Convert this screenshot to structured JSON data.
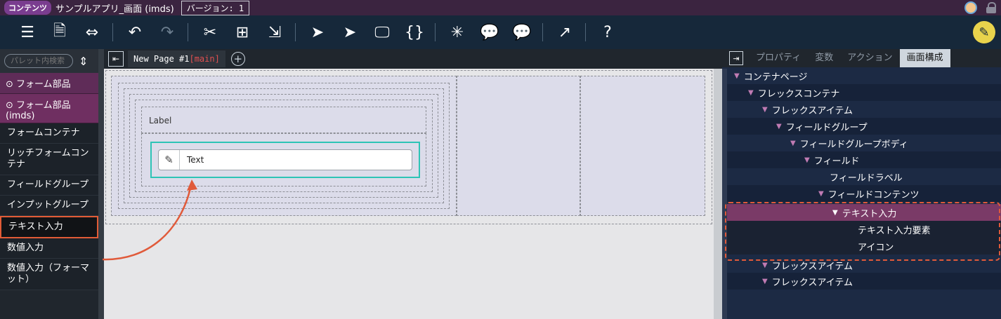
{
  "titlebar": {
    "badge": "コンテンツ",
    "app_title": "サンプルアプリ_画面 (imds)",
    "version": "バージョン: 1"
  },
  "toolbar": {
    "icons": [
      "database-stack-icon",
      "document-download-icon",
      "swap-horizontal-icon",
      "undo-icon",
      "redo-icon",
      "scissors-icon",
      "tree-grid-icon",
      "move-out-icon",
      "pointer-icon",
      "pointer-hover-icon",
      "monitor-icon",
      "css-file-icon",
      "sparkle-icon",
      "chat-edit-icon",
      "chat-settings-icon",
      "external-link-icon",
      "help-icon"
    ],
    "glyphs": [
      "☰",
      "🗎",
      "⇔",
      "↶",
      "↷",
      "✂",
      "⊞",
      "⇲",
      "➤",
      "➤",
      "🖵",
      "{}",
      "✳",
      "💬",
      "💬",
      "↗",
      "?"
    ],
    "edit_mode_icon": "pencil-circle-icon",
    "edit_mode_glyph": "✎"
  },
  "palette": {
    "search_placeholder": "パレット内検索",
    "categories": [
      {
        "label": "⊙ フォーム部品"
      },
      {
        "label": "⊙ フォーム部品 (imds)"
      }
    ],
    "items": [
      {
        "label": "フォームコンテナ"
      },
      {
        "label": "リッチフォームコンテナ"
      },
      {
        "label": "フィールドグループ"
      },
      {
        "label": "インプットグループ"
      },
      {
        "label": "テキスト入力"
      },
      {
        "label": "数値入力"
      },
      {
        "label": "数値入力（フォーマット）"
      }
    ]
  },
  "editor": {
    "page_tab": "New Page #1",
    "page_tab_suffix": "[main]",
    "label_text": "Label",
    "text_value": "Text"
  },
  "right_panel": {
    "tabs": [
      "プロパティ",
      "変数",
      "アクション",
      "画面構成"
    ],
    "active_tab": "画面構成",
    "tree": [
      {
        "label": "コンテナページ",
        "arrow": "▼"
      },
      {
        "label": "フレックスコンテナ",
        "arrow": "▼"
      },
      {
        "label": "フレックスアイテム",
        "arrow": "▼"
      },
      {
        "label": "フィールドグループ",
        "arrow": "▼"
      },
      {
        "label": "フィールドグループボディ",
        "arrow": "▼"
      },
      {
        "label": "フィールド",
        "arrow": "▼"
      },
      {
        "label": "フィールドラベル",
        "arrow": ""
      },
      {
        "label": "フィールドコンテンツ",
        "arrow": "▼"
      },
      {
        "label": "テキスト入力",
        "arrow": "▼"
      },
      {
        "label": "テキスト入力要素",
        "arrow": ""
      },
      {
        "label": "アイコン",
        "arrow": ""
      },
      {
        "label": "フレックスアイテム",
        "arrow": "▼"
      },
      {
        "label": "フレックスアイテム",
        "arrow": "▼"
      }
    ]
  },
  "colors": {
    "highlight_orange": "#e05a3a",
    "selection_teal": "#2ec4b6",
    "selected_row": "#7a3a67"
  }
}
